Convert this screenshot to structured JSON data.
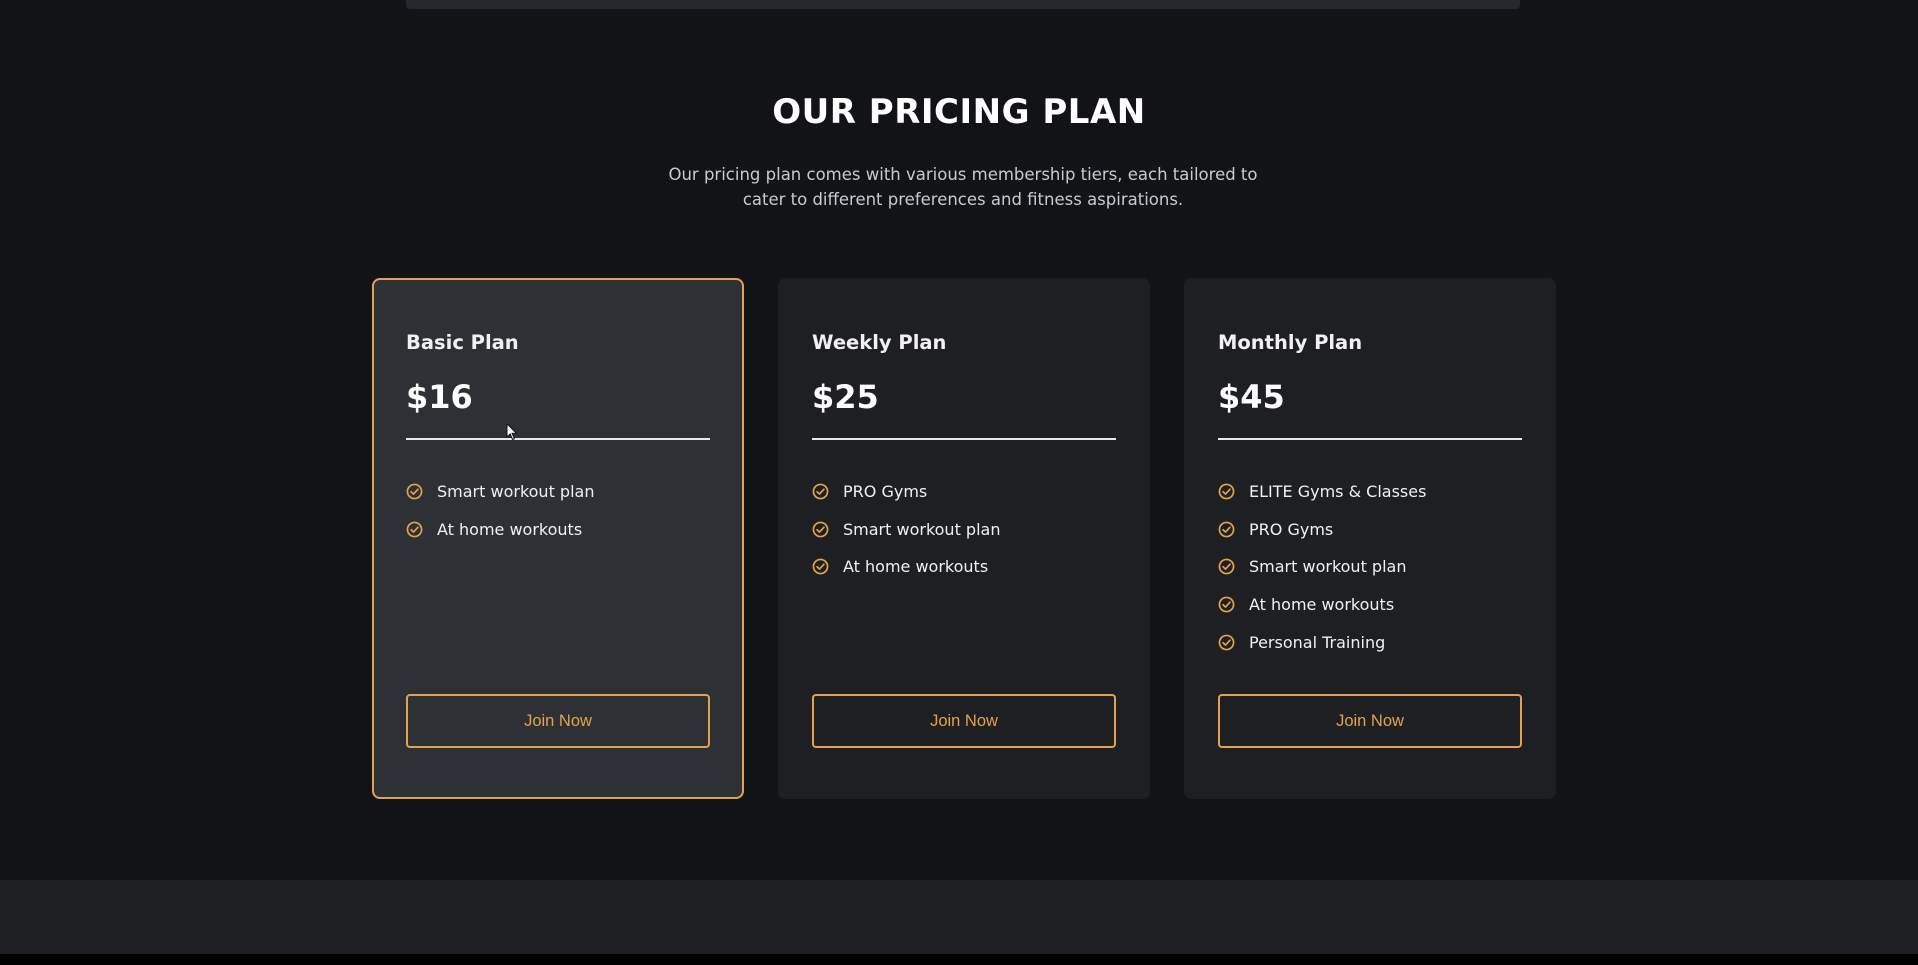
{
  "section": {
    "title": "OUR PRICING PLAN",
    "subtitle": "Our pricing plan comes with various membership tiers, each tailored to cater to different preferences and fitness aspirations."
  },
  "plans": [
    {
      "name": "Basic Plan",
      "price": "$16",
      "features": [
        "Smart workout plan",
        "At home workouts"
      ],
      "button_label": "Join Now",
      "featured": true
    },
    {
      "name": "Weekly Plan",
      "price": "$25",
      "features": [
        "PRO Gyms",
        "Smart workout plan",
        "At home workouts"
      ],
      "button_label": "Join Now",
      "featured": false
    },
    {
      "name": "Monthly Plan",
      "price": "$45",
      "features": [
        "ELITE Gyms & Classes",
        "PRO Gyms",
        "Smart workout plan",
        "At home workouts",
        "Personal Training"
      ],
      "button_label": "Join Now",
      "featured": false
    }
  ],
  "icons": {
    "feature_bullet": "check-circle-icon",
    "pointer": "mouse-cursor-icon"
  },
  "colors": {
    "accent": "#e3a24c",
    "page_background": "#111317",
    "card_background": "#1d1f23",
    "featured_card_background": "#2d3034"
  }
}
